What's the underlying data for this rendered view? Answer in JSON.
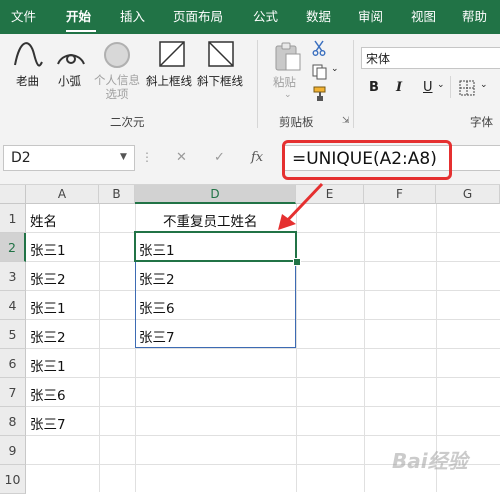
{
  "menu": {
    "items": [
      "文件",
      "开始",
      "插入",
      "页面布局",
      "公式",
      "数据",
      "审阅",
      "视图",
      "帮助"
    ],
    "active": "开始"
  },
  "ribbon": {
    "shapes": {
      "buttons": [
        {
          "label": "老曲",
          "icon": "curve-icon"
        },
        {
          "label": "小弧",
          "icon": "arc-icon"
        },
        {
          "label": "个人信息选项",
          "icon": "circle-icon",
          "disabled": true
        },
        {
          "label": "斜上框线",
          "icon": "diagonal-up-border-icon"
        },
        {
          "label": "斜下框线",
          "icon": "diagonal-down-border-icon"
        }
      ],
      "group_title": "二次元"
    },
    "clipboard": {
      "paste_label": "粘贴",
      "group_title": "剪贴板"
    },
    "font": {
      "font_name": "宋体",
      "bold_label": "B",
      "italic_label": "I",
      "underline_label": "U",
      "group_title": "字体"
    }
  },
  "formula_bar": {
    "name_box": "D2",
    "cancel_glyph": "✕",
    "enter_glyph": "✓",
    "fx_glyph": "fx",
    "formula": "=UNIQUE(A2:A8)"
  },
  "grid": {
    "columns": [
      "A",
      "B",
      "D",
      "E",
      "F",
      "G"
    ],
    "selected_column": "D",
    "rows": [
      "1",
      "2",
      "3",
      "4",
      "5",
      "6",
      "7",
      "8",
      "9",
      "10"
    ],
    "selected_row": "2",
    "col_a": [
      "姓名",
      "张三1",
      "张三2",
      "张三1",
      "张三2",
      "张三1",
      "张三6",
      "张三7"
    ],
    "col_d_header": "不重复员工姓名",
    "col_d_values": [
      "张三1",
      "张三2",
      "张三6",
      "张三7"
    ]
  },
  "colors": {
    "excel_green": "#217346",
    "highlight_red": "#e53030",
    "spill_border": "#3d6bb3"
  }
}
